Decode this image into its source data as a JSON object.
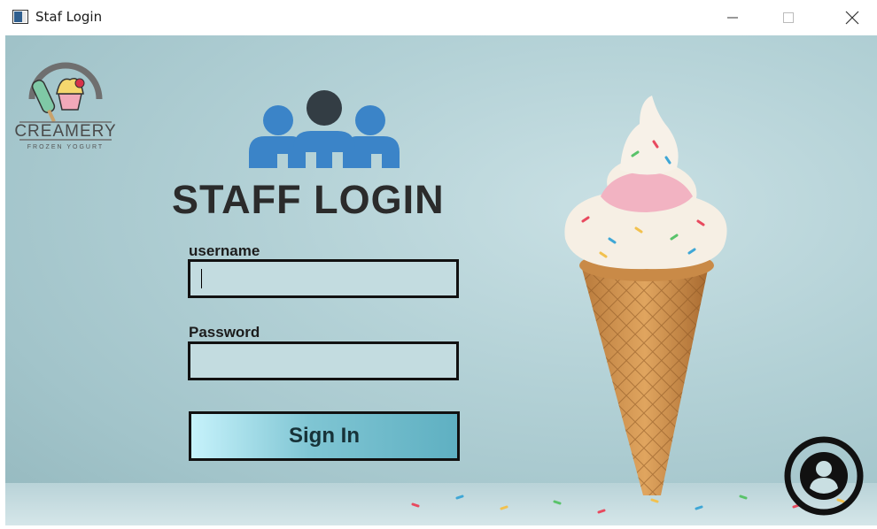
{
  "window": {
    "title": "Staf Login",
    "controls": {
      "minimize": "minimize-icon",
      "maximize": "maximize-icon",
      "close": "close-icon"
    }
  },
  "logo": {
    "brand": "CREAMERY",
    "tagline": "FROZEN YOGURT"
  },
  "heading": "STAFF LOGIN",
  "form": {
    "username_label": "username",
    "username_value": "",
    "password_label": "Password",
    "password_value": "",
    "signin_label": "Sign In"
  },
  "icons": {
    "staff": "users-group-icon",
    "profile": "user-profile-icon",
    "hero": "ice-cream-cone-image"
  },
  "colors": {
    "accent": "#3b84c8",
    "dark": "#2b2b2b",
    "field_bg": "#c3dce0",
    "button_start": "#c6f2fb",
    "button_end": "#5fb0c2"
  }
}
